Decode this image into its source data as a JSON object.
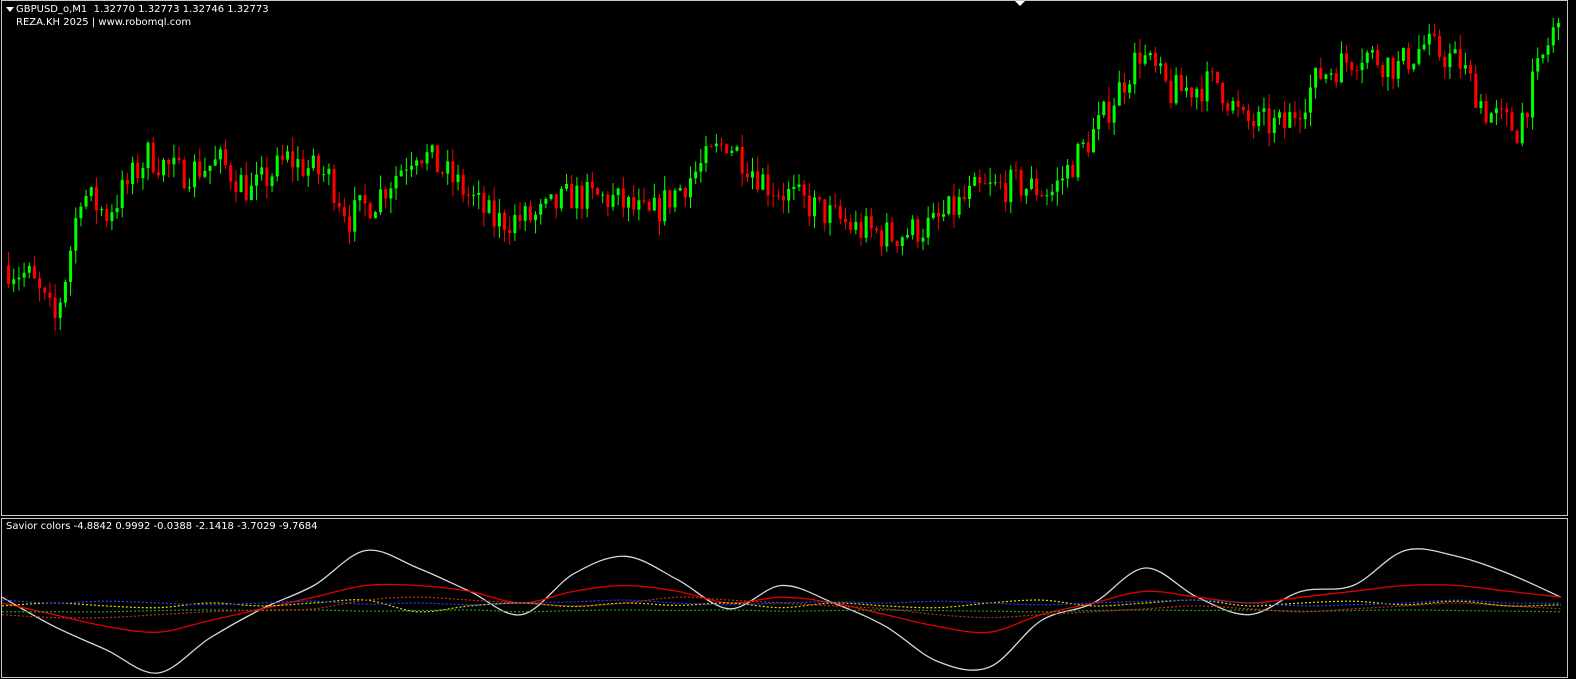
{
  "chart": {
    "symbol_line": "GBPUSD_o,M1  1.32770 1.32773 1.32746 1.32773",
    "author_line": "REZA.KH 2025 | www.robomql.com",
    "indicator_line": "Savior colors -4.8842 0.9992 -0.0388 -2.1418 -3.7029 -9.7684"
  },
  "colors": {
    "background": "#000000",
    "bull": "#00ff00",
    "bear": "#ff0000",
    "line_white": "#d8d8d8",
    "line_red": "#e00000",
    "dot_yellow": "#e0e000",
    "dot_blue": "#2040ff",
    "dot_green": "#20a020",
    "dot_red": "#c03020",
    "border": "#c8c8c8"
  },
  "chart_data": [
    {
      "type": "candlestick",
      "title": "GBPUSD_o,M1",
      "ohlc_last": {
        "open": 1.3277,
        "high": 1.32773,
        "low": 1.32746,
        "close": 1.32773
      },
      "ylim": [
        1.315,
        1.329
      ],
      "keyframes": [
        [
          0,
          1.3218
        ],
        [
          5,
          1.3215
        ],
        [
          10,
          1.3203
        ],
        [
          12,
          1.3215
        ],
        [
          15,
          1.3238
        ],
        [
          20,
          1.3232
        ],
        [
          28,
          1.3248
        ],
        [
          34,
          1.3243
        ],
        [
          42,
          1.3246
        ],
        [
          48,
          1.3238
        ],
        [
          55,
          1.3247
        ],
        [
          63,
          1.3242
        ],
        [
          67,
          1.3231
        ],
        [
          72,
          1.3236
        ],
        [
          80,
          1.325
        ],
        [
          88,
          1.324
        ],
        [
          95,
          1.323
        ],
        [
          103,
          1.3231
        ],
        [
          110,
          1.3237
        ],
        [
          118,
          1.3236
        ],
        [
          125,
          1.3231
        ],
        [
          133,
          1.3242
        ],
        [
          140,
          1.3252
        ],
        [
          148,
          1.324
        ],
        [
          158,
          1.3233
        ],
        [
          165,
          1.3228
        ],
        [
          172,
          1.3226
        ],
        [
          180,
          1.3229
        ],
        [
          188,
          1.3238
        ],
        [
          196,
          1.324
        ],
        [
          203,
          1.3238
        ],
        [
          212,
          1.3256
        ],
        [
          220,
          1.3276
        ],
        [
          226,
          1.3265
        ],
        [
          235,
          1.3268
        ],
        [
          240,
          1.3257
        ],
        [
          248,
          1.3256
        ],
        [
          255,
          1.327
        ],
        [
          263,
          1.3276
        ],
        [
          270,
          1.3272
        ],
        [
          275,
          1.3278
        ],
        [
          282,
          1.3273
        ],
        [
          287,
          1.326
        ],
        [
          293,
          1.3255
        ],
        [
          300,
          1.3282
        ]
      ]
    },
    {
      "type": "line",
      "title": "Savior colors",
      "values_last": [
        -4.8842,
        0.9992,
        -0.0388,
        -2.1418,
        -3.7029,
        -9.7684
      ],
      "ylim": [
        -12,
        12
      ],
      "x": [
        0,
        10,
        20,
        30,
        40,
        50,
        60,
        70,
        80,
        90,
        100,
        110,
        120,
        130,
        140,
        150,
        160,
        170,
        180,
        190,
        200,
        210,
        220,
        230,
        240,
        250,
        260,
        270,
        280,
        290,
        300
      ],
      "series": [
        {
          "color": "#d8d8d8",
          "style": "solid",
          "values": [
            1,
            -4,
            -8,
            -12,
            -6,
            -1,
            3,
            9,
            6,
            2,
            -2,
            5,
            8,
            4,
            -1,
            3,
            0,
            -4,
            -10,
            -11,
            -3,
            0,
            6,
            1,
            -2,
            2,
            3,
            9,
            8,
            5,
            1
          ]
        },
        {
          "color": "#e00000",
          "style": "solid",
          "values": [
            0,
            -2,
            -4,
            -5,
            -3,
            -1,
            1,
            3,
            3,
            2,
            0,
            2,
            3,
            2,
            0,
            1,
            0,
            -2,
            -4,
            -5,
            -2,
            0,
            2,
            1,
            0,
            1,
            2,
            3,
            3,
            2,
            1
          ]
        },
        {
          "color": "#e0e000",
          "style": "dotted",
          "values": [
            -0.5,
            0,
            -0.5,
            -0.8,
            0,
            -0.5,
            0,
            0.5,
            -1.5,
            -0.5,
            0,
            -0.6,
            0,
            -0.4,
            0,
            -0.8,
            0,
            -0.5,
            -0.8,
            0,
            0.5,
            -0.5,
            0,
            0.5,
            -0.5,
            0,
            0.3,
            -0.3,
            0.3,
            -0.5,
            -0.3
          ]
        },
        {
          "color": "#2040ff",
          "style": "dotted",
          "values": [
            0.5,
            0,
            0.3,
            0,
            -0.3,
            0,
            0.3,
            -0.2,
            0,
            -0.3,
            0,
            0.2,
            0.5,
            0,
            -0.3,
            0,
            0.2,
            0,
            0.3,
            0,
            -0.3,
            0,
            0.3,
            0.5,
            0,
            -0.5,
            -0.3,
            0,
            0.5,
            0,
            0
          ]
        },
        {
          "color": "#20a020",
          "style": "dotted",
          "values": [
            -1.5,
            -1.5,
            -1.5,
            -1.3,
            -1.2,
            -1.3,
            -1.2,
            -1.4,
            -1.3,
            -1.2,
            -1.5,
            -1.3,
            -1.2,
            -1.3,
            -1.2,
            -1.4,
            -1.3,
            -1.2,
            -1.3,
            -1.4,
            -1.5,
            -1.3,
            -1.2,
            -1.3,
            -1.2,
            -1.4,
            -1.3,
            -1.2,
            -1.3,
            -1.4,
            -1.5
          ]
        },
        {
          "color": "#c03020",
          "style": "dotted",
          "values": [
            -2,
            -2.5,
            -2.5,
            -2,
            -1.5,
            -1.2,
            -1,
            0.5,
            1,
            0.5,
            0,
            -0.5,
            0,
            1,
            0.5,
            0,
            -0.5,
            -1,
            -2,
            -2.5,
            -2,
            -1.5,
            -1,
            -0.5,
            -1,
            -1.5,
            -1,
            -0.5,
            0,
            -0.5,
            -1
          ]
        }
      ]
    }
  ]
}
